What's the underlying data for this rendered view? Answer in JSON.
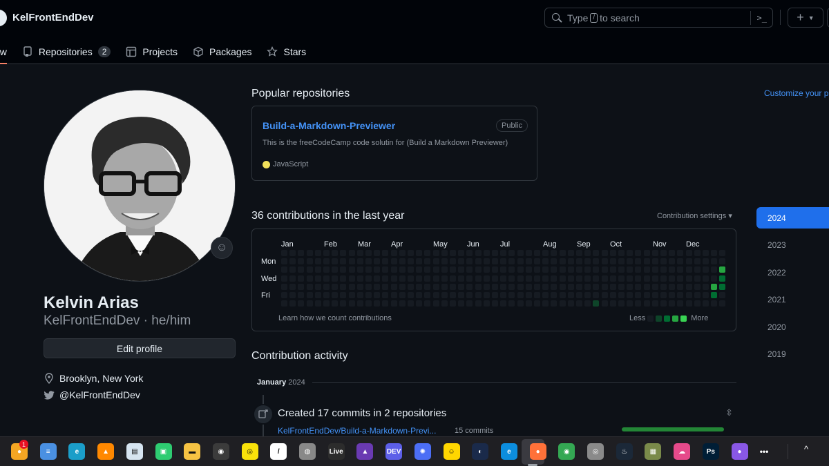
{
  "header": {
    "username": "KelFrontEndDev",
    "search_placeholder_pre": "Type",
    "search_key": "/",
    "search_placeholder_post": "to search",
    "cmd_glyph": ">_",
    "plus_glyph": "+"
  },
  "tabs": [
    {
      "label": "Overview",
      "visible_label": "ew",
      "icon": "book-icon",
      "active": true
    },
    {
      "label": "Repositories",
      "icon": "repo-icon",
      "count": "2"
    },
    {
      "label": "Projects",
      "icon": "table-icon"
    },
    {
      "label": "Packages",
      "icon": "package-icon"
    },
    {
      "label": "Stars",
      "icon": "star-icon"
    }
  ],
  "profile": {
    "name": "Kelvin Arias",
    "handle": "KelFrontEndDev · he/him",
    "edit_label": "Edit profile",
    "location": "Brooklyn, New York",
    "twitter": "@KelFrontEndDev",
    "emoji_glyph": "☺"
  },
  "popular": {
    "title": "Popular repositories",
    "customize": "Customize your pins",
    "repo": {
      "name": "Build-a-Markdown-Previewer",
      "visibility": "Public",
      "description": "This is the freeCodeCamp code solutin for (Build a Markdown Previewer)",
      "language": "JavaScript",
      "language_color": "#f1e05a"
    }
  },
  "contributions": {
    "title": "36 contributions in the last year",
    "settings_label": "Contribution settings ▾",
    "months": [
      "Jan",
      "Feb",
      "Mar",
      "Apr",
      "May",
      "Jun",
      "Jul",
      "Aug",
      "Sep",
      "Oct",
      "Nov",
      "Dec"
    ],
    "days": [
      "Mon",
      "Wed",
      "Fri"
    ],
    "learn": "Learn how we count contributions",
    "less": "Less",
    "more": "More",
    "level_colors": [
      "#161b22",
      "#0e4429",
      "#006d32",
      "#26a641",
      "#39d353"
    ],
    "weeks": 53,
    "active_cells": [
      {
        "week": 37,
        "day": 6,
        "level": 1
      },
      {
        "week": 51,
        "day": 4,
        "level": 3
      },
      {
        "week": 51,
        "day": 5,
        "level": 2
      },
      {
        "week": 52,
        "day": 2,
        "level": 3
      },
      {
        "week": 52,
        "day": 3,
        "level": 2
      },
      {
        "week": 52,
        "day": 4,
        "level": 2
      }
    ]
  },
  "activity": {
    "title": "Contribution activity",
    "month": "January",
    "year": "2024",
    "item_title": "Created 17 commits in 2 repositories",
    "item_repo": "KelFrontEndDev/Build-a-Markdown-Previ...",
    "item_commits": "15 commits",
    "collapse_glyph": "⇳"
  },
  "years": [
    "2024",
    "2023",
    "2022",
    "2021",
    "2020",
    "2019"
  ],
  "selected_year": "2024",
  "taskbar": {
    "notification_count": "1",
    "live_label": "Live",
    "dev_label": "DEV",
    "ps_label": "Ps",
    "more_glyph": "•••",
    "tray_glyph": "^",
    "apps": [
      {
        "name": "app-icon",
        "color": "#f5a623",
        "glyph": "●"
      },
      {
        "name": "notepad-icon",
        "color": "#4a90e2",
        "glyph": "≡"
      },
      {
        "name": "edge-dev-icon",
        "color": "#1b9ec9",
        "glyph": "e"
      },
      {
        "name": "vlc-icon",
        "color": "#ff8800",
        "glyph": "▲"
      },
      {
        "name": "document-icon",
        "color": "#d6e4f0",
        "glyph": "▤"
      },
      {
        "name": "robot-icon",
        "color": "#2ecc71",
        "glyph": "▣"
      },
      {
        "name": "folder-icon",
        "color": "#f6c343",
        "glyph": "▬"
      },
      {
        "name": "obs-icon",
        "color": "#3b3b3b",
        "glyph": "◉"
      },
      {
        "name": "camera-icon",
        "color": "#f9e20a",
        "glyph": "◎"
      },
      {
        "name": "kebab-icon",
        "color": "#ffffff",
        "glyph": "/"
      },
      {
        "name": "vpn-icon",
        "color": "#888888",
        "glyph": "◍"
      },
      {
        "name": "live-icon",
        "color": "#2c2c2c",
        "glyph": "Live"
      },
      {
        "name": "affinity-icon",
        "color": "#6a3ab2",
        "glyph": "▲"
      },
      {
        "name": "dev-icon",
        "color": "#5d5fe8",
        "glyph": "DEV"
      },
      {
        "name": "gear-app-icon",
        "color": "#4c6ef5",
        "glyph": "✺"
      },
      {
        "name": "cyberghost-icon",
        "color": "#ffd600",
        "glyph": "☺"
      },
      {
        "name": "cinema-icon",
        "color": "#1a2a4a",
        "glyph": "◐"
      },
      {
        "name": "edge-icon",
        "color": "#0c8dde",
        "glyph": "e"
      },
      {
        "name": "firefox-icon",
        "color": "#ff7139",
        "glyph": "●"
      },
      {
        "name": "chrome-icon",
        "color": "#34a853",
        "glyph": "◉"
      },
      {
        "name": "app-circle-icon",
        "color": "#8a8a8a",
        "glyph": "◎"
      },
      {
        "name": "steam-icon",
        "color": "#1b2838",
        "glyph": "♨"
      },
      {
        "name": "robot2-icon",
        "color": "#7a8a4a",
        "glyph": "▦"
      },
      {
        "name": "cloud-icon",
        "color": "#e64a8a",
        "glyph": "☁"
      },
      {
        "name": "photoshop-icon",
        "color": "#001e36",
        "glyph": "Ps"
      },
      {
        "name": "github-icon",
        "color": "#8957e5",
        "glyph": "●"
      }
    ]
  }
}
